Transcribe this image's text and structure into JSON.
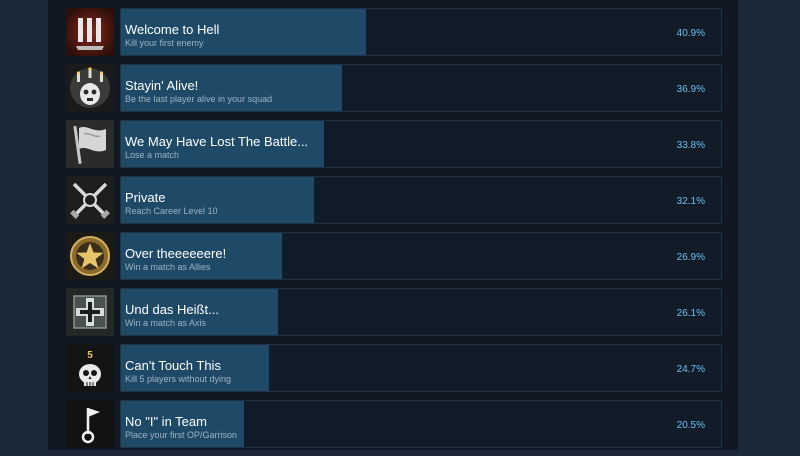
{
  "achievements": [
    {
      "title": "Welcome to Hell",
      "desc": "Kill your first enemy",
      "percent": "40.9%",
      "fraction": 0.409,
      "icon": "three-bars-icon"
    },
    {
      "title": "Stayin' Alive!",
      "desc": "Be the last player alive in your squad",
      "percent": "36.9%",
      "fraction": 0.369,
      "icon": "candle-skull-icon"
    },
    {
      "title": "We May Have Lost The Battle...",
      "desc": "Lose a match",
      "percent": "33.8%",
      "fraction": 0.338,
      "icon": "white-flag-icon"
    },
    {
      "title": "Private",
      "desc": "Reach Career Level 10",
      "percent": "32.1%",
      "fraction": 0.321,
      "icon": "crossed-rifles-icon"
    },
    {
      "title": "Over theeeeeere!",
      "desc": "Win a match as Allies",
      "percent": "26.9%",
      "fraction": 0.269,
      "icon": "allied-star-icon"
    },
    {
      "title": "Und das Heißt...",
      "desc": "Win a match as Axis",
      "percent": "26.1%",
      "fraction": 0.261,
      "icon": "axis-cross-icon"
    },
    {
      "title": "Can't Touch This",
      "desc": "Kill 5 players without dying",
      "percent": "24.7%",
      "fraction": 0.247,
      "icon": "skull-five-icon",
      "icon_badge": "5"
    },
    {
      "title": "No \"I\" in Team",
      "desc": "Place your first OP/Garrison",
      "percent": "20.5%",
      "fraction": 0.205,
      "icon": "outpost-flag-icon"
    }
  ],
  "colors": {
    "page_bg": "#1b2838",
    "panel_bg": "#0f1823",
    "bar_bg": "#121c28",
    "bar_fill": "#1e4a67",
    "percent_text": "#67c1f5",
    "desc_text": "#9fb2c3"
  }
}
